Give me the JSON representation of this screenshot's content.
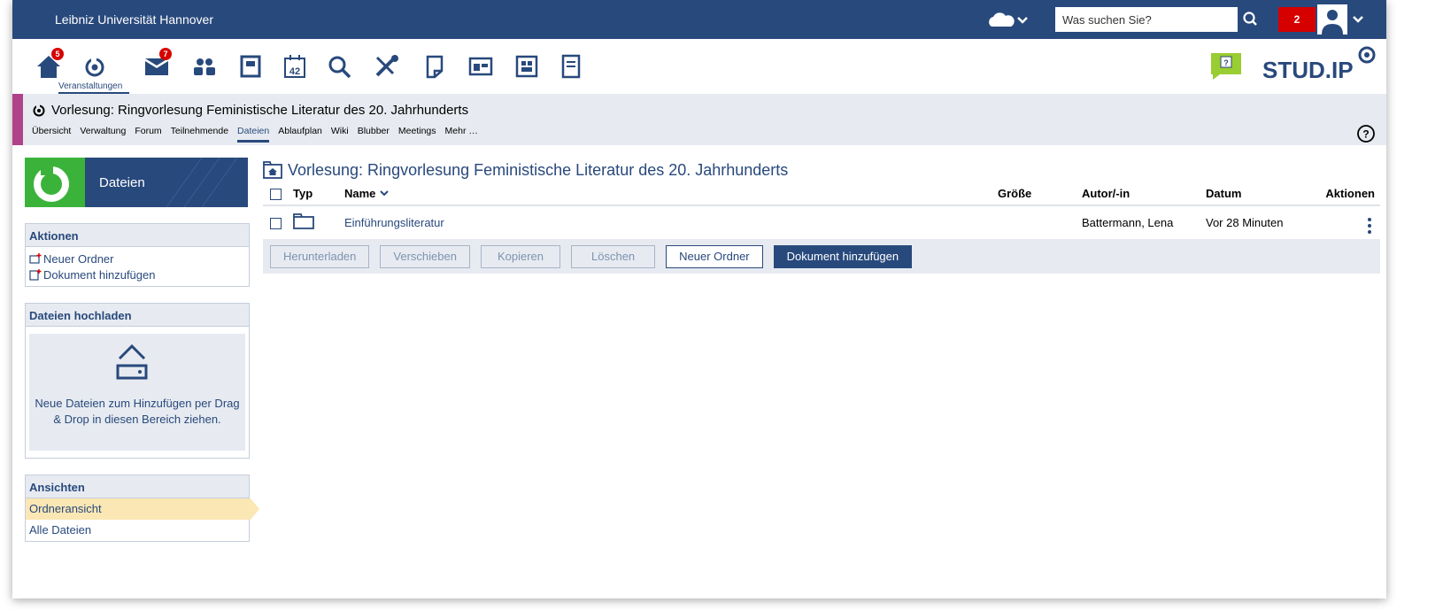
{
  "topbar": {
    "brand": "Leibniz Universität Hannover",
    "search_placeholder": "Was suchen Sie?",
    "notification_count": "2"
  },
  "navbar": {
    "items": [
      {
        "icon": "home-icon",
        "badge": "5"
      },
      {
        "icon": "courses-icon",
        "label": "Veranstaltungen"
      },
      {
        "icon": "messages-icon",
        "badge": "7"
      },
      {
        "icon": "community-icon"
      },
      {
        "icon": "profile-icon"
      },
      {
        "icon": "calendar-icon",
        "day": "42"
      },
      {
        "icon": "search-icon"
      },
      {
        "icon": "tools-icon"
      },
      {
        "icon": "files-icon"
      },
      {
        "icon": "resources-icon"
      },
      {
        "icon": "contents-icon"
      },
      {
        "icon": "notes-icon"
      }
    ],
    "logo_text": "STUD.IP"
  },
  "context": {
    "title": "Vorlesung: Ringvorlesung Feministische Literatur des 20. Jahrhunderts",
    "tabs": [
      "Übersicht",
      "Verwaltung",
      "Forum",
      "Teilnehmende",
      "Dateien",
      "Ablaufplan",
      "Wiki",
      "Blubber",
      "Meetings",
      "Mehr …"
    ],
    "active_tab": "Dateien"
  },
  "sidebar": {
    "header": "Dateien",
    "actions_title": "Aktionen",
    "actions": [
      "Neuer Ordner",
      "Dokument hinzufügen"
    ],
    "upload_title": "Dateien hochladen",
    "upload_text": "Neue Dateien zum Hinzufügen per Drag & Drop in diesen Bereich ziehen.",
    "views_title": "Ansichten",
    "views": [
      "Ordneransicht",
      "Alle Dateien"
    ],
    "active_view": "Ordneransicht"
  },
  "main": {
    "folder_title": "Vorlesung: Ringvorlesung Feministische Literatur des 20. Jahrhunderts",
    "columns": {
      "type": "Typ",
      "name": "Name",
      "size": "Größe",
      "author": "Autor/-in",
      "date": "Datum",
      "actions": "Aktionen"
    },
    "rows": [
      {
        "name": "Einführungsliteratur",
        "size": "",
        "author": "Battermann, Lena",
        "date": "Vor 28 Minuten"
      }
    ],
    "buttons": {
      "download": "Herunterladen",
      "move": "Verschieben",
      "copy": "Kopieren",
      "delete": "Löschen",
      "new_folder": "Neuer Ordner",
      "add_document": "Dokument hinzufügen"
    }
  },
  "colors": {
    "brand_blue": "#28497c",
    "course_accent": "#b0428a",
    "badge_red": "#d60000",
    "active_view": "#fbe7b4"
  }
}
